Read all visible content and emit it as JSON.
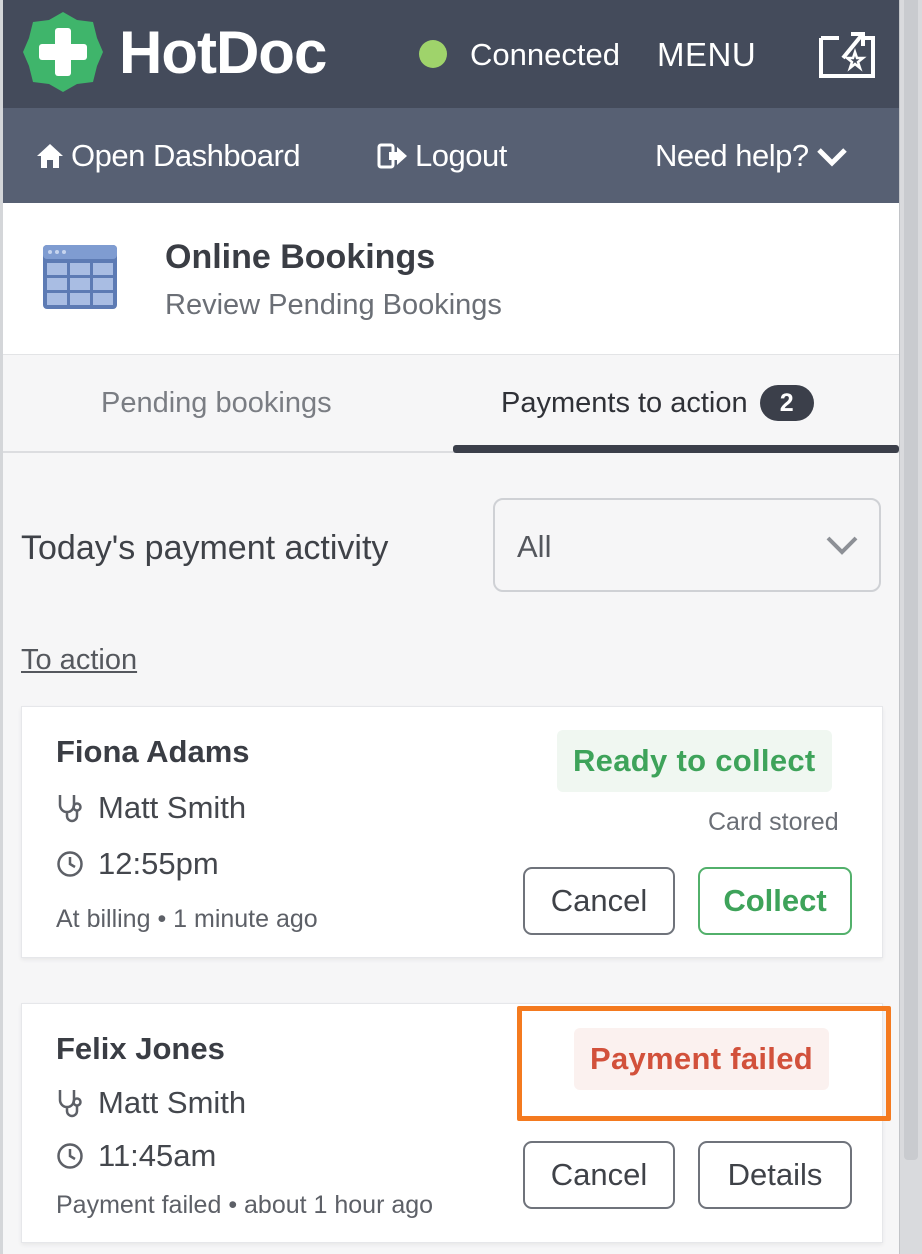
{
  "app": {
    "brand": "HotDoc",
    "connection_status": "Connected",
    "menu_label": "MENU",
    "accent_color": "#444b5b",
    "status_dot_color": "#9fd36b"
  },
  "subnav": {
    "dashboard_label": "Open Dashboard",
    "logout_label": "Logout",
    "help_label": "Need help?"
  },
  "section": {
    "title": "Online Bookings",
    "subtitle": "Review Pending Bookings"
  },
  "tabs": [
    {
      "label": "Pending bookings",
      "active": false
    },
    {
      "label": "Payments to action",
      "active": true,
      "badge": "2"
    }
  ],
  "filter": {
    "label": "Today's payment activity",
    "selected": "All"
  },
  "to_action_label": "To action",
  "bookings": [
    {
      "patient": "Fiona Adams",
      "practitioner": "Matt Smith",
      "time": "12:55pm",
      "meta": "At billing • 1 minute ago",
      "status": "Ready to collect",
      "status_color": "#3ea35a",
      "note": "Card stored",
      "actions": [
        "Cancel",
        "Collect"
      ]
    },
    {
      "patient": "Felix Jones",
      "practitioner": "Matt Smith",
      "time": "11:45am",
      "meta": "Payment failed • about 1 hour ago",
      "status": "Payment failed",
      "status_color": "#d2513b",
      "actions": [
        "Cancel",
        "Details"
      ]
    }
  ],
  "highlight_color": "#f47a1f"
}
